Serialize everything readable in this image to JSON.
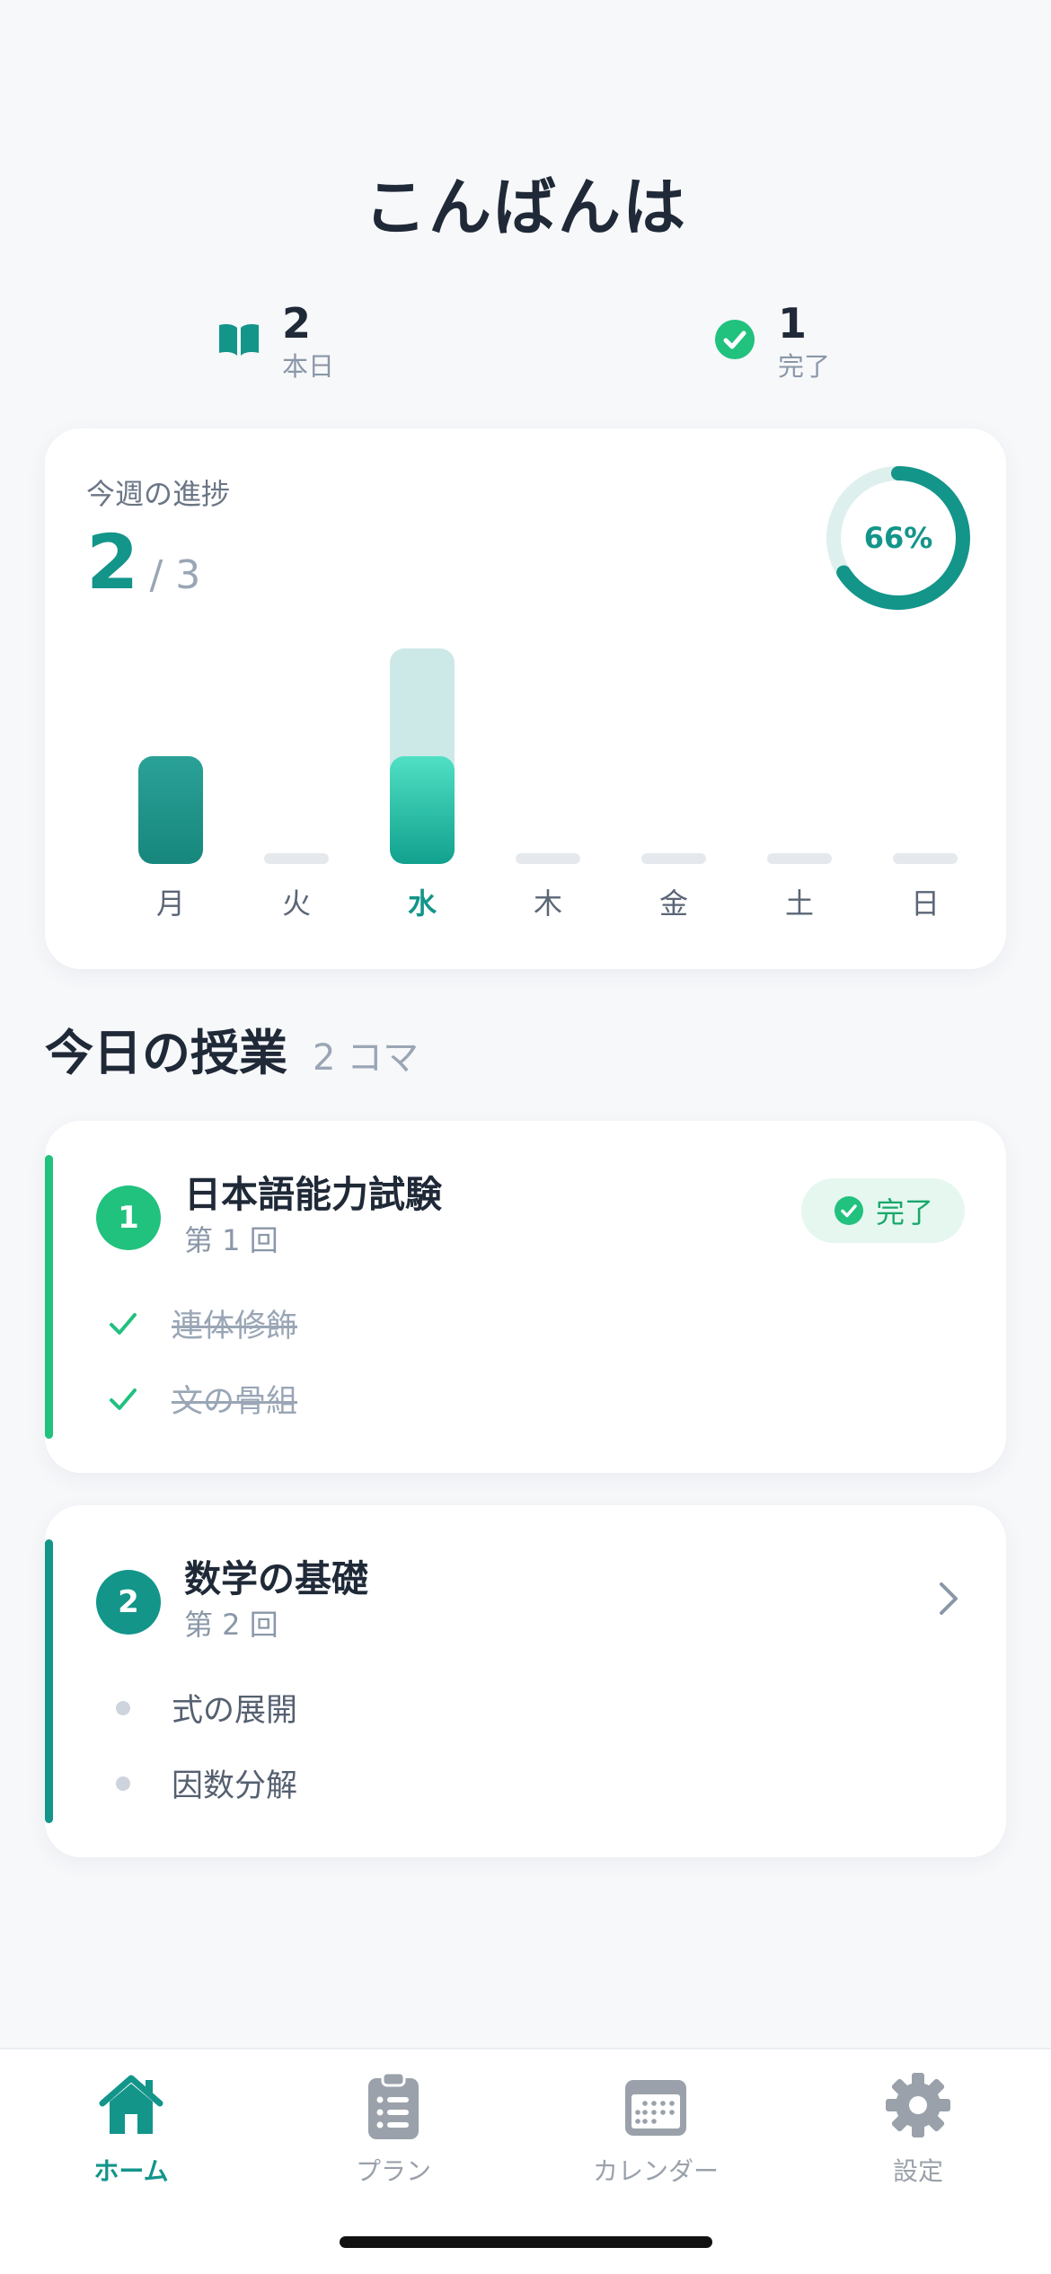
{
  "greeting": "こんばんは",
  "summary": {
    "today": {
      "value": "2",
      "label": "本日",
      "icon": "book-icon"
    },
    "done": {
      "value": "1",
      "label": "完了",
      "icon": "check-circle-icon"
    }
  },
  "weekly": {
    "title": "今週の進捗",
    "completed": "2",
    "total": "/ 3",
    "percent_label": "66%",
    "percent": 0.66
  },
  "chart_data": {
    "type": "bar",
    "categories": [
      "月",
      "火",
      "水",
      "木",
      "金",
      "土",
      "日"
    ],
    "series": [
      {
        "values": [
          1,
          0,
          1,
          0,
          0,
          0,
          0
        ]
      },
      {
        "values": [
          1,
          0,
          2,
          0,
          0,
          0,
          0
        ]
      }
    ],
    "highlight_category": "水",
    "ylim": [
      0,
      2
    ]
  },
  "section": {
    "title": "今日の授業",
    "count": "2 コマ"
  },
  "lessons": [
    {
      "number": "1",
      "title": "日本語能力試験",
      "subtitle": "第 1 回",
      "status": "完了",
      "topics": [
        "連体修飾",
        "文の骨組"
      ]
    },
    {
      "number": "2",
      "title": "数学の基礎",
      "subtitle": "第 2 回",
      "topics": [
        "式の展開",
        "因数分解"
      ]
    }
  ],
  "tabs": [
    {
      "label": "ホーム",
      "icon": "home-icon"
    },
    {
      "label": "プラン",
      "icon": "clipboard-icon"
    },
    {
      "label": "カレンダー",
      "icon": "calendar-icon"
    },
    {
      "label": "設定",
      "icon": "gear-icon"
    }
  ],
  "colors": {
    "accent": "#13958a",
    "success": "#21c17e",
    "bar_done": "#1a9b8f",
    "bar_light": "#cde9e7",
    "bar_empty": "#e5e9ee"
  }
}
